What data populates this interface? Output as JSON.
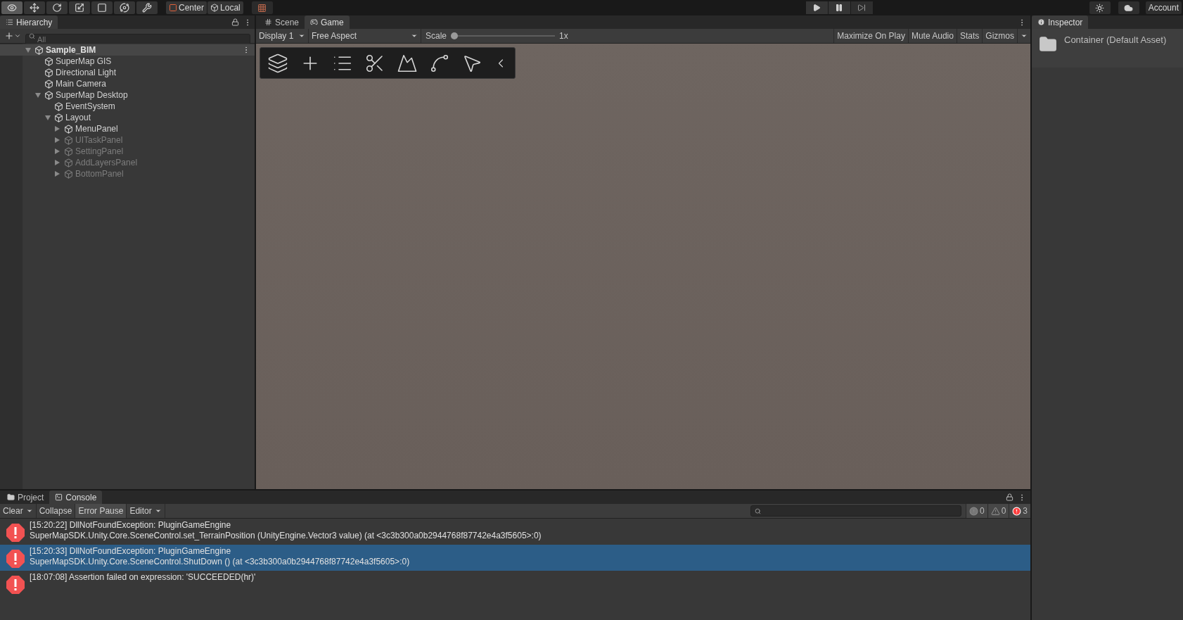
{
  "toolbar": {
    "tools": [
      {
        "kind": "view",
        "selected": true
      },
      {
        "kind": "move",
        "selected": false
      },
      {
        "kind": "rotate",
        "selected": false
      },
      {
        "kind": "scale",
        "selected": false
      },
      {
        "kind": "rect",
        "selected": false
      },
      {
        "kind": "transform",
        "selected": false
      },
      {
        "kind": "custom",
        "selected": false
      }
    ],
    "pivot_buttons": [
      {
        "kind": "center",
        "label": "Center"
      },
      {
        "kind": "local",
        "label": "Local"
      }
    ],
    "account": "Account"
  },
  "hierarchy": {
    "title": "Hierarchy",
    "search": {
      "placeholder": "All"
    },
    "tree": [
      {
        "label": "Sample_BIM",
        "kind": "scene",
        "expanded": true,
        "children": [
          {
            "label": "SuperMap GIS",
            "active": true
          },
          {
            "label": "Directional Light",
            "active": true
          },
          {
            "label": "Main Camera",
            "active": true
          },
          {
            "label": "SuperMap Desktop",
            "expanded": true,
            "active": true,
            "children": [
              {
                "label": "EventSystem",
                "active": true
              },
              {
                "label": "Layout",
                "expanded": true,
                "active": true,
                "children": [
                  {
                    "label": "MenuPanel",
                    "expanded": false,
                    "active": true
                  },
                  {
                    "label": "UITaskPanel",
                    "expanded": false,
                    "active": false
                  },
                  {
                    "label": "SettingPanel",
                    "expanded": false,
                    "active": false
                  },
                  {
                    "label": "AddLayersPanel",
                    "expanded": false,
                    "active": false
                  },
                  {
                    "label": "BottomPanel",
                    "expanded": false,
                    "active": false
                  }
                ]
              }
            ]
          }
        ]
      }
    ]
  },
  "view_tabs": [
    {
      "label": "Scene",
      "kind": "scene",
      "selected": false
    },
    {
      "label": "Game",
      "kind": "game",
      "selected": true
    }
  ],
  "game_toolbar": {
    "display": "Display 1",
    "aspect": "Free Aspect",
    "scale_label": "Scale",
    "scale": {
      "level": 0
    },
    "scale_reading": "1x",
    "toggles": [
      {
        "label": "Maximize On Play",
        "on": false
      },
      {
        "label": "Mute Audio",
        "on": false
      },
      {
        "label": "Stats",
        "on": false
      },
      {
        "label": "Gizmos",
        "on": false
      }
    ]
  },
  "game_overlay": {
    "tools": [
      {
        "kind": "layers"
      },
      {
        "kind": "plus"
      },
      {
        "kind": "list"
      },
      {
        "kind": "scissors"
      },
      {
        "kind": "mountains"
      },
      {
        "kind": "polyline"
      },
      {
        "kind": "pointer"
      },
      {
        "kind": "collapse"
      }
    ]
  },
  "inspector": {
    "title": "Inspector",
    "asset": "Container (Default Asset)"
  },
  "bottom_tabs": [
    {
      "label": "Project",
      "kind": "project",
      "selected": false
    },
    {
      "label": "Console",
      "kind": "console",
      "selected": true
    }
  ],
  "console": {
    "buttons": [
      {
        "label": "Clear",
        "dropdown": true,
        "on": false
      },
      {
        "label": "Collapse",
        "dropdown": false,
        "on": false
      },
      {
        "label": "Error Pause",
        "dropdown": false,
        "on": true
      },
      {
        "label": "Editor",
        "dropdown": true,
        "on": false
      }
    ],
    "counts": [
      {
        "kind": "info",
        "value": "0"
      },
      {
        "kind": "warning",
        "value": "0"
      },
      {
        "kind": "error",
        "value": "3"
      }
    ],
    "entries": [
      {
        "kind": "error",
        "selected": false,
        "lines": [
          "[15:20:22] DllNotFoundException: PluginGameEngine",
          "SuperMapSDK.Unity.Core.SceneControl.set_TerrainPosition (UnityEngine.Vector3 value) (at <3c3b300a0b2944768f87742e4a3f5605>:0)"
        ]
      },
      {
        "kind": "error",
        "selected": true,
        "lines": [
          "[15:20:33] DllNotFoundException: PluginGameEngine",
          "SuperMapSDK.Unity.Core.SceneControl.ShutDown () (at <3c3b300a0b2944768f87742e4a3f5605>:0)"
        ]
      },
      {
        "kind": "error",
        "selected": false,
        "lines": [
          "[18:07:08] Assertion failed on expression: 'SUCCEEDED(hr)'"
        ]
      }
    ]
  }
}
